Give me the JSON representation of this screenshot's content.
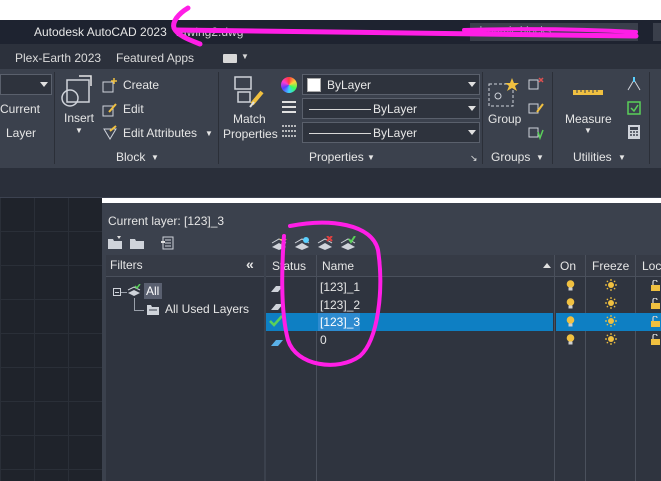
{
  "titlebar": {
    "app_title": "Autodesk AutoCAD 2023",
    "file_name": "rawing2.dwg",
    "search_text": "dynamic blocks ..."
  },
  "tabs": [
    {
      "label": "Plex-Earth 2023"
    },
    {
      "label": "Featured Apps"
    }
  ],
  "ribbon": {
    "layers_panel": {
      "current_label": "Current",
      "layer_label": "Layer"
    },
    "block_panel": {
      "insert_label": "Insert",
      "create_label": "Create",
      "edit_label": "Edit",
      "edit_attributes_label": "Edit Attributes",
      "footer": "Block"
    },
    "properties_panel": {
      "match_label_1": "Match",
      "match_label_2": "Properties",
      "color_value": "ByLayer",
      "linetype_value": "ByLayer",
      "lineweight_value": "ByLayer",
      "footer": "Properties"
    },
    "groups_panel": {
      "group_label": "Group",
      "footer": "Groups"
    },
    "utilities_panel": {
      "measure_label": "Measure",
      "footer": "Utilities"
    }
  },
  "layer_manager": {
    "current_layer": "Current layer: [123]_3",
    "filters_title": "Filters",
    "filters_collapse": "«",
    "filter_tree": {
      "root": "All",
      "child": "All Used Layers"
    },
    "columns": [
      "Status",
      "Name",
      "On",
      "Freeze",
      "Loc"
    ],
    "rows": [
      {
        "name": "[123]_1",
        "selected": false,
        "current": false
      },
      {
        "name": "[123]_2",
        "selected": false,
        "current": false
      },
      {
        "name": "[123]_3",
        "selected": true,
        "current": true
      },
      {
        "name": "0",
        "selected": false,
        "current": false
      }
    ]
  },
  "colors": {
    "annotation": "#ff1ee6",
    "selection": "#0e7fc3",
    "background": "#3b414d"
  }
}
